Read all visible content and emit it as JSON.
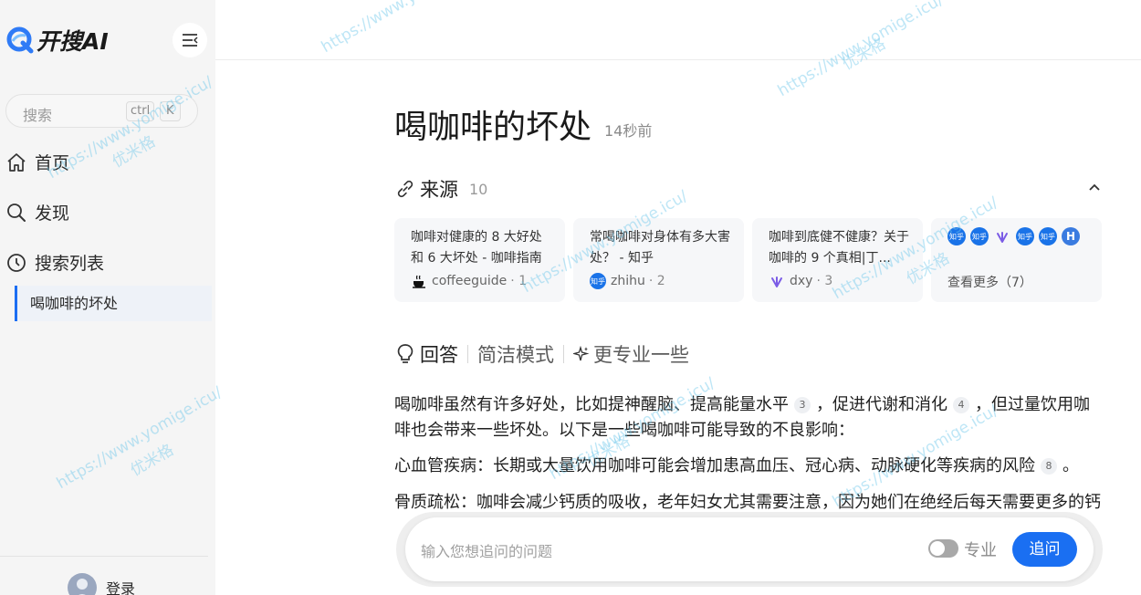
{
  "app": {
    "logo_text": "开搜AI"
  },
  "sidebar": {
    "search_placeholder": "搜索",
    "shortcut_ctrl": "ctrl",
    "shortcut_k": "K",
    "nav": [
      {
        "label": "首页",
        "icon": "home-icon"
      },
      {
        "label": "发现",
        "icon": "search-icon"
      },
      {
        "label": "搜索列表",
        "icon": "history-icon"
      }
    ],
    "history": [
      {
        "label": "喝咖啡的坏处",
        "active": true
      }
    ],
    "login_label": "登录"
  },
  "main": {
    "title": "喝咖啡的坏处",
    "time_ago": "14秒前",
    "sources": {
      "heading": "来源",
      "count": "10",
      "cards": [
        {
          "title": "咖啡对健康的 8 大好处和 6 大坏处 - 咖啡指南",
          "source": "coffeeguide",
          "index": "· 1"
        },
        {
          "title": "常喝咖啡对身体有多大害处？ - 知乎",
          "source": "zhihu",
          "index": "· 2"
        },
        {
          "title": "咖啡到底健不健康？关于咖啡的 9 个真相|丁...",
          "source": "dxy",
          "index": "· 3"
        }
      ],
      "more_label": "查看更多（7）",
      "more_icons": [
        "知乎",
        "知乎",
        "dxy",
        "知乎",
        "知乎",
        "H"
      ]
    },
    "answer": {
      "heading": "回答",
      "mode_simple": "简洁模式",
      "mode_pro": "更专业一些",
      "paragraphs": {
        "p1_a": "喝咖啡虽然有许多好处，比如提神醒脑、提高能量水平",
        "p1_c1": "3",
        "p1_b": "，促进代谢和消化",
        "p1_c2": "4",
        "p1_c": "，但过量饮用咖啡也会带来一些坏处。以下是一些喝咖啡可能导致的不良影响：",
        "p2_a": "心血管疾病：长期或大量饮用咖啡可能会增加患高血压、冠心病、动脉硬化等疾病的风险",
        "p2_c1": "8",
        "p2_b": "。",
        "p3": "骨质疏松：咖啡会减少钙质的吸收，老年妇女尤其需要注意，因为她们在绝经后每天需要更多的钙"
      }
    }
  },
  "followup": {
    "placeholder": "输入您想追问的问题",
    "pro_label": "专业",
    "pro_enabled": false,
    "submit_label": "追问"
  },
  "watermark": {
    "url": "https://www.yomige.icu/",
    "name": "优米格"
  },
  "colors": {
    "accent": "#1a6ff2",
    "sidebar_bg": "#f5f5f5",
    "card_bg": "#f6f7f9"
  }
}
